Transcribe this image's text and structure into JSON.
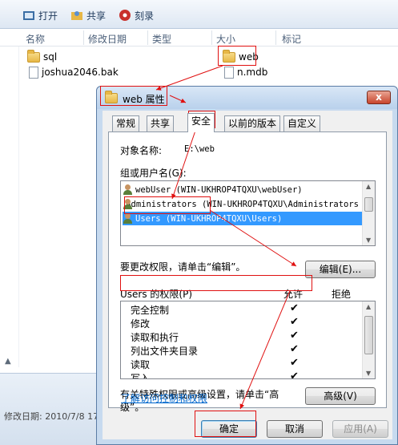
{
  "explorer": {
    "toolbar": {
      "open": "打开",
      "share": "共享",
      "burn": "刻录"
    },
    "columns": {
      "name": "名称",
      "modified": "修改日期",
      "type": "类型",
      "size": "大小",
      "tags": "标记"
    },
    "files": [
      {
        "name": "sql",
        "kind": "folder"
      },
      {
        "name": "joshua2046.bak",
        "kind": "file"
      }
    ],
    "right_files": [
      {
        "name": "web",
        "kind": "folder"
      },
      {
        "name": "n.mdb",
        "kind": "file"
      }
    ],
    "details_text": "修改日期: 2010/7/8 17"
  },
  "dialog": {
    "title": "web 属性",
    "close_label": "x",
    "tabs": [
      "常规",
      "共享",
      "安全",
      "以前的版本",
      "自定义"
    ],
    "active_tab": "安全",
    "object_name_label": "对象名称:",
    "object_name_value": "E:\\web",
    "group_label": "组或用户名(G):",
    "users": [
      "webUser (WIN-UKHROP4TQXU\\webUser)",
      "Administrators (WIN-UKHROP4TQXU\\Administrators",
      "Users (WIN-UKHROP4TQXU\\Users)"
    ],
    "selected_user_index": 2,
    "change_hint": "要更改权限，请单击“编辑”。",
    "edit_button": "编辑(E)...",
    "perm_header": "Users 的权限(P)",
    "allow_label": "允许",
    "deny_label": "拒绝",
    "permissions": [
      {
        "name": "完全控制",
        "allow": "✔"
      },
      {
        "name": "修改",
        "allow": "✔"
      },
      {
        "name": "读取和执行",
        "allow": "✔"
      },
      {
        "name": "列出文件夹目录",
        "allow": "✔"
      },
      {
        "name": "读取",
        "allow": "✔"
      },
      {
        "name": "写入",
        "allow": "✔"
      }
    ],
    "special_hint_1": "有关特殊权限或高级设置，请单击“高",
    "special_hint_2": "级”。",
    "advanced_button": "高级(V)",
    "learn_link": "了解访问控制和权限",
    "ok_button": "确定",
    "cancel_button": "取消",
    "apply_button": "应用(A)"
  },
  "colors": {
    "highlight": "#3399ff",
    "annotation": "#e01010",
    "link": "#0066cc"
  }
}
